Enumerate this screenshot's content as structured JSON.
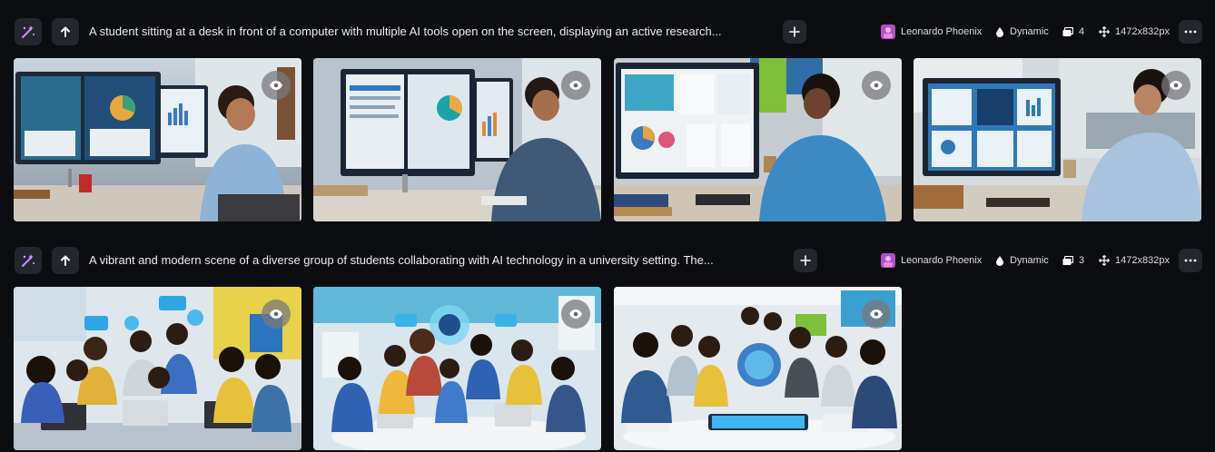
{
  "generations": [
    {
      "prompt": "A student sitting at a desk in front of a computer with multiple AI tools open on the screen, displaying an active research...",
      "model": "Leonardo Phoenix",
      "style": "Dynamic",
      "image_count": "4",
      "dimensions": "1472x832px",
      "images": [
        "image-1",
        "image-2",
        "image-3",
        "image-4"
      ]
    },
    {
      "prompt": "A vibrant and modern scene of a diverse group of students collaborating with AI technology in a university setting. The...",
      "model": "Leonardo Phoenix",
      "style": "Dynamic",
      "image_count": "3",
      "dimensions": "1472x832px",
      "images": [
        "image-1",
        "image-2",
        "image-3"
      ]
    }
  ],
  "icons": {
    "remix": "wand-sparkle-icon",
    "upload": "arrow-up-icon",
    "add": "plus-icon",
    "model": "leonardo-model-icon",
    "style": "drop-icon",
    "count": "images-stack-icon",
    "dimensions": "move-arrows-icon",
    "more": "ellipsis-icon",
    "view": "eye-icon"
  },
  "colors": {
    "background": "#0c0d11",
    "button": "#24262e",
    "accent": "#a855f7"
  }
}
